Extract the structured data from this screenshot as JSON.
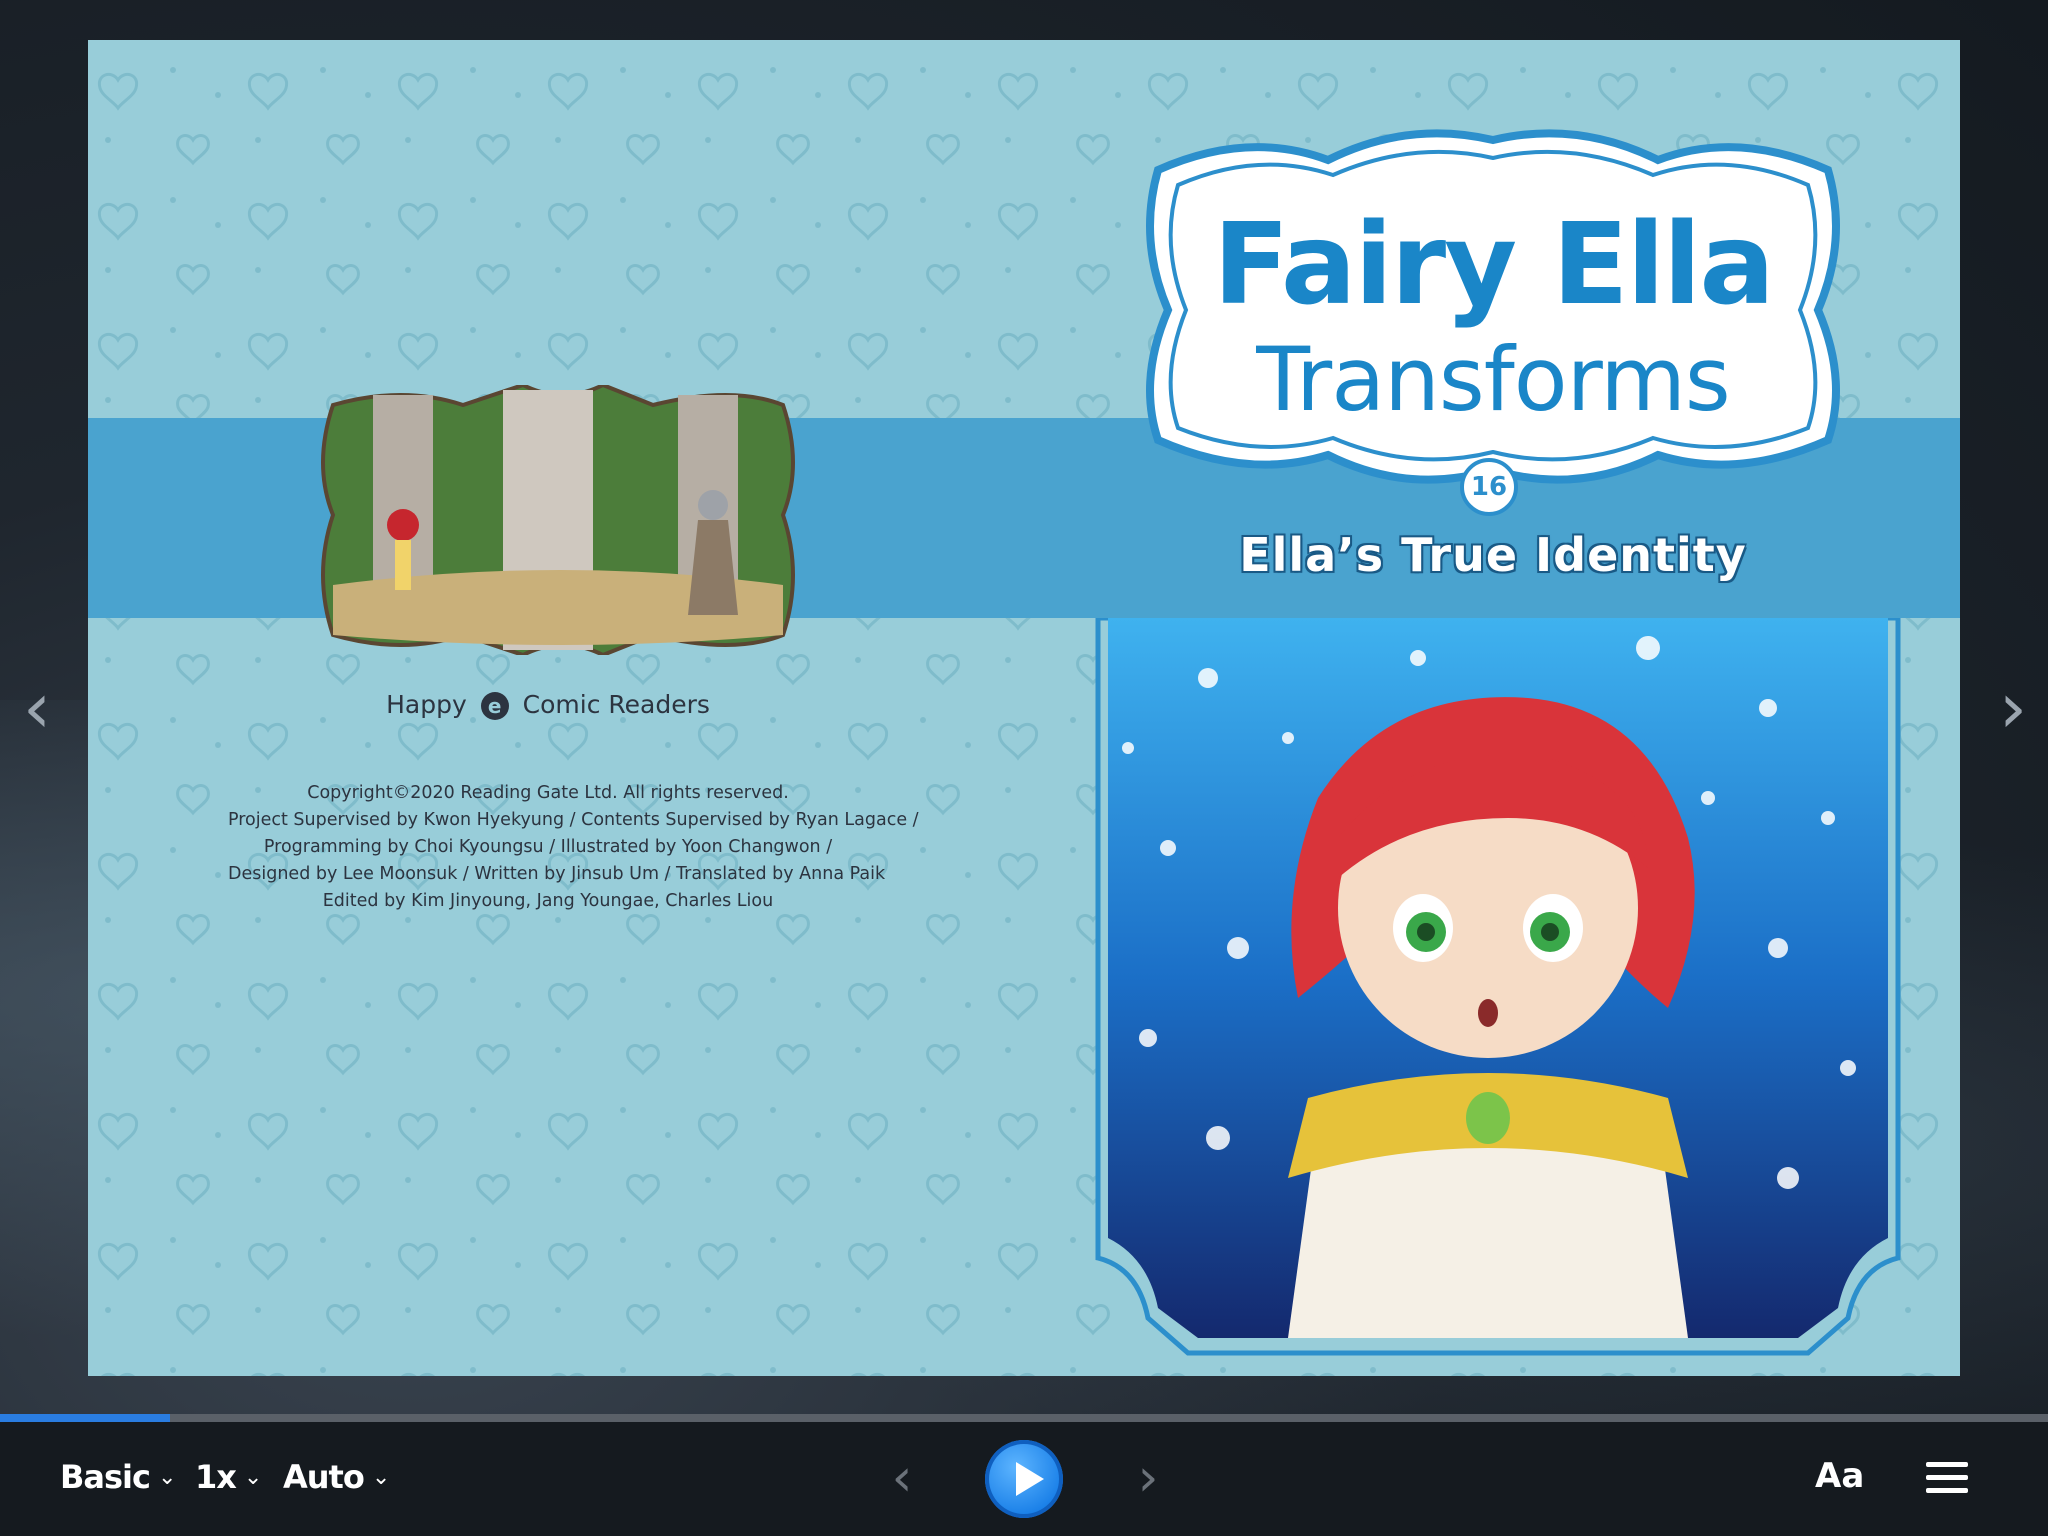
{
  "book": {
    "series_title_line1": "Fairy Ella",
    "series_title_line2": "Transforms",
    "volume_number": "16",
    "subtitle": "Ella’s True Identity",
    "publisher_left": "Happy",
    "publisher_mark": "e",
    "publisher_right": "Comic Readers",
    "credits": [
      "Copyright©2020 Reading Gate Ltd. All rights reserved.",
      "Project Supervised by Kwon Hyekyung / Contents Supervised by Ryan Lagace /",
      "Programming by Choi Kyoungsu / Illustrated by Yoon Changwon /",
      "Designed by Lee Moonsuk / Written by Jinsub Um / Translated by Anna Paik",
      "Edited by Kim Jinyoung, Jang Youngae, Charles Liou"
    ]
  },
  "nav": {
    "prev_page": "‹",
    "next_page": "›"
  },
  "progress": {
    "fraction": 0.083
  },
  "toolbar": {
    "mode_label": "Basic",
    "speed_label": "1x",
    "auto_label": "Auto",
    "chevron": "⌄",
    "prev_label": "‹",
    "next_label": "›",
    "font_label": "Aa"
  },
  "colors": {
    "page_bg": "#98cdd9",
    "band": "#4aa3cf",
    "title_blue": "#1a86c8",
    "accent": "#2a7de1"
  }
}
